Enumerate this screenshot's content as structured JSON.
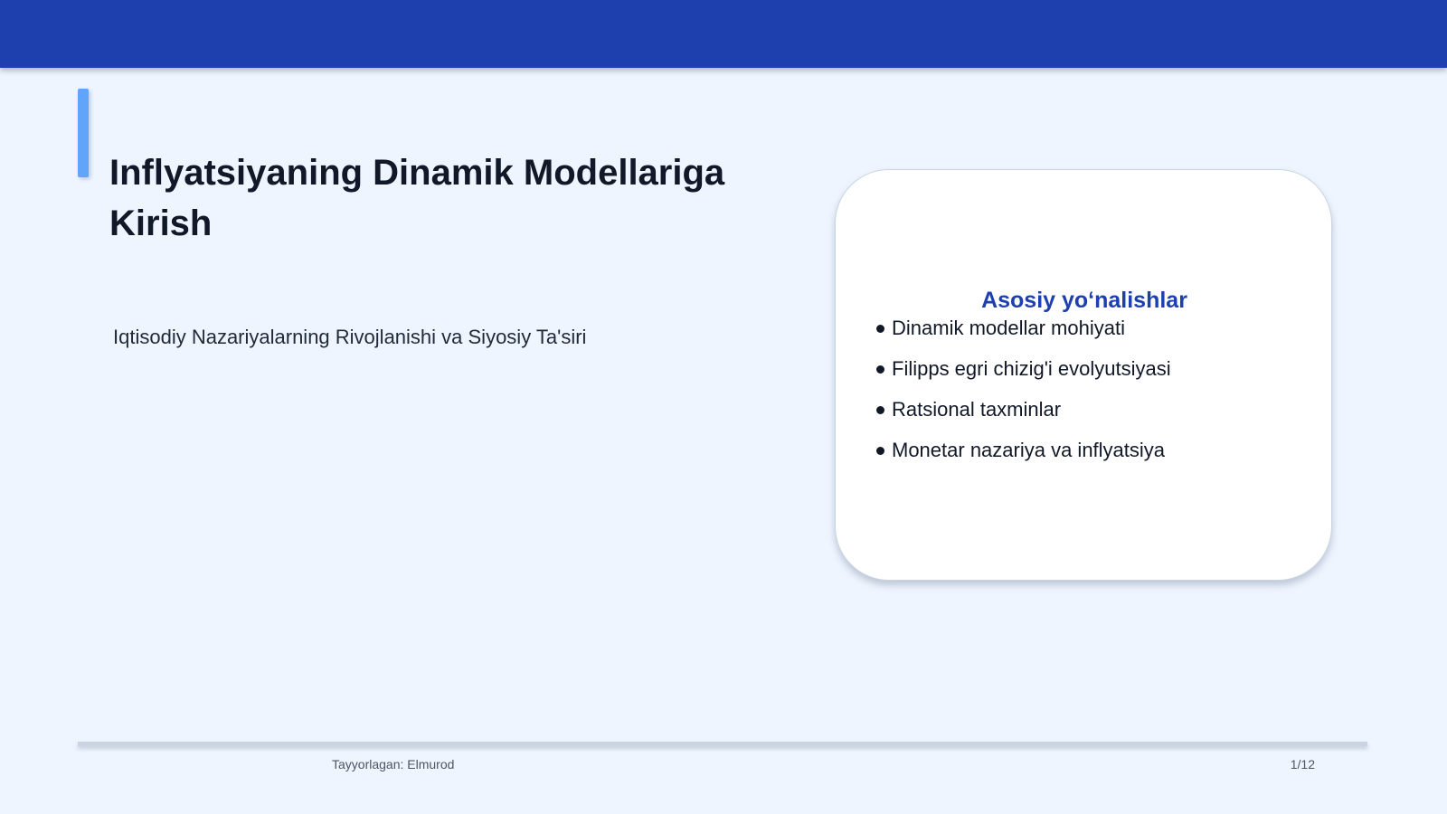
{
  "slide": {
    "title": "Inflyatsiyaning Dinamik Modellariga Kirish",
    "subtitle": "Iqtisodiy Nazariyalarning Rivojlanishi va Siyosiy Ta'siri"
  },
  "card": {
    "heading": "Asosiy yo‘nalishlar",
    "items": [
      "Dinamik modellar mohiyati",
      "Filipps egri chizig'i evolyutsiyasi",
      "Ratsional taxminlar",
      "Monetar nazariya va inflyatsiya"
    ]
  },
  "footer": {
    "author": "Tayyorlagan: Elmurod",
    "page": "1/12"
  },
  "colors": {
    "header_bar": "#1e40af",
    "accent": "#60a5fa",
    "background": "#eef5ff",
    "card_heading": "#1e40af"
  }
}
